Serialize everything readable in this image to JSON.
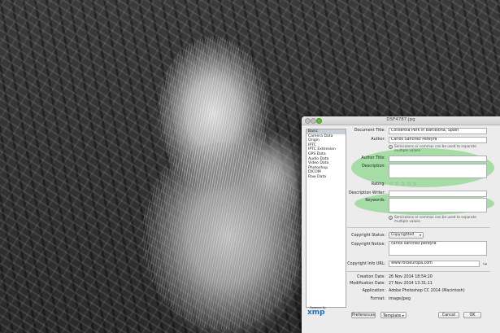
{
  "window": {
    "title": "DSF4787.jpg"
  },
  "categories": [
    {
      "label": "Basic",
      "selected": true
    },
    {
      "label": "Camera Data",
      "selected": false
    },
    {
      "label": "Origin",
      "selected": false
    },
    {
      "label": "IPTC",
      "selected": false
    },
    {
      "label": "IPTC Extension",
      "selected": false
    },
    {
      "label": "GPS Data",
      "selected": false
    },
    {
      "label": "Audio Data",
      "selected": false
    },
    {
      "label": "Video Data",
      "selected": false
    },
    {
      "label": "Photoshop",
      "selected": false
    },
    {
      "label": "DICOM",
      "selected": false
    },
    {
      "label": "Raw Data",
      "selected": false
    }
  ],
  "branding": {
    "powered_by": "Powered By",
    "logo": "xmp"
  },
  "fields": {
    "document_title": {
      "label": "Document Title:",
      "value": "Collserola Park in Barcelona, Spain"
    },
    "author": {
      "label": "Author:",
      "value": "Carlos Sanchez Pereyra"
    },
    "author_hint": "Semicolons or commas can be used to separate multiple values",
    "author_title": {
      "label": "Author Title:",
      "value": ""
    },
    "description": {
      "label": "Description:",
      "value": ""
    },
    "rating": {
      "label": "Rating:",
      "stars": 5,
      "filled": 0
    },
    "description_writer": {
      "label": "Description Writer:",
      "value": ""
    },
    "keywords": {
      "label": "Keywords:",
      "value": ""
    },
    "keywords_hint": "Semicolons or commas can be used to separate multiple values",
    "copyright_status": {
      "label": "Copyright Status:",
      "value": "Copyrighted"
    },
    "copyright_notice": {
      "label": "Copyright Notice:",
      "value": "carlos sanchez pereyra"
    },
    "copyright_info_url": {
      "label": "Copyright Info URL:",
      "value": "www.fotoeuropa.com"
    }
  },
  "info": {
    "creation_date": {
      "label": "Creation Date:",
      "value": "26 Nov 2014 18:54:20"
    },
    "modification_date": {
      "label": "Modification Date:",
      "value": "27 Nov 2014 13:31:11"
    },
    "application": {
      "label": "Application:",
      "value": "Adobe Photoshop CC 2014 (Macintosh)"
    },
    "format": {
      "label": "Format:",
      "value": "image/jpeg"
    }
  },
  "buttons": {
    "preferences": "Preferences",
    "template": "Template",
    "cancel": "Cancel",
    "ok": "OK"
  },
  "icons": {
    "info": "info-icon",
    "star": "star-outline-icon",
    "go_to_url": "arrow-go-icon",
    "dropdown": "chevron-down-icon"
  },
  "colors": {
    "highlight": "#6ed26e",
    "accent_traffic_zoom": "#5fc038"
  }
}
